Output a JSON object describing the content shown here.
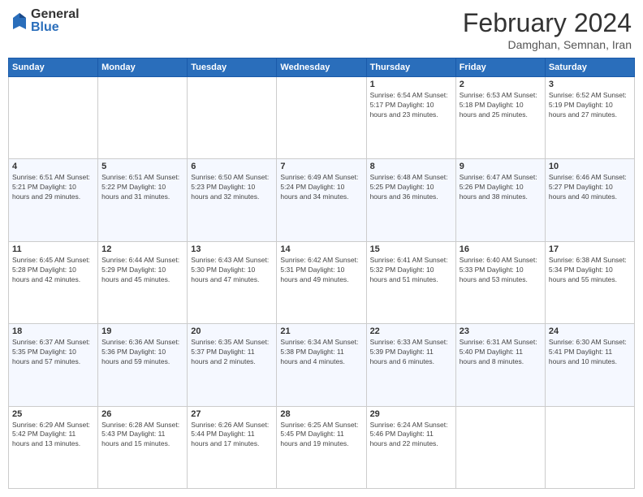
{
  "header": {
    "logo_general": "General",
    "logo_blue": "Blue",
    "title": "February 2024",
    "location": "Damghan, Semnan, Iran"
  },
  "days_of_week": [
    "Sunday",
    "Monday",
    "Tuesday",
    "Wednesday",
    "Thursday",
    "Friday",
    "Saturday"
  ],
  "weeks": [
    [
      {
        "day": "",
        "info": ""
      },
      {
        "day": "",
        "info": ""
      },
      {
        "day": "",
        "info": ""
      },
      {
        "day": "",
        "info": ""
      },
      {
        "day": "1",
        "info": "Sunrise: 6:54 AM\nSunset: 5:17 PM\nDaylight: 10 hours\nand 23 minutes."
      },
      {
        "day": "2",
        "info": "Sunrise: 6:53 AM\nSunset: 5:18 PM\nDaylight: 10 hours\nand 25 minutes."
      },
      {
        "day": "3",
        "info": "Sunrise: 6:52 AM\nSunset: 5:19 PM\nDaylight: 10 hours\nand 27 minutes."
      }
    ],
    [
      {
        "day": "4",
        "info": "Sunrise: 6:51 AM\nSunset: 5:21 PM\nDaylight: 10 hours\nand 29 minutes."
      },
      {
        "day": "5",
        "info": "Sunrise: 6:51 AM\nSunset: 5:22 PM\nDaylight: 10 hours\nand 31 minutes."
      },
      {
        "day": "6",
        "info": "Sunrise: 6:50 AM\nSunset: 5:23 PM\nDaylight: 10 hours\nand 32 minutes."
      },
      {
        "day": "7",
        "info": "Sunrise: 6:49 AM\nSunset: 5:24 PM\nDaylight: 10 hours\nand 34 minutes."
      },
      {
        "day": "8",
        "info": "Sunrise: 6:48 AM\nSunset: 5:25 PM\nDaylight: 10 hours\nand 36 minutes."
      },
      {
        "day": "9",
        "info": "Sunrise: 6:47 AM\nSunset: 5:26 PM\nDaylight: 10 hours\nand 38 minutes."
      },
      {
        "day": "10",
        "info": "Sunrise: 6:46 AM\nSunset: 5:27 PM\nDaylight: 10 hours\nand 40 minutes."
      }
    ],
    [
      {
        "day": "11",
        "info": "Sunrise: 6:45 AM\nSunset: 5:28 PM\nDaylight: 10 hours\nand 42 minutes."
      },
      {
        "day": "12",
        "info": "Sunrise: 6:44 AM\nSunset: 5:29 PM\nDaylight: 10 hours\nand 45 minutes."
      },
      {
        "day": "13",
        "info": "Sunrise: 6:43 AM\nSunset: 5:30 PM\nDaylight: 10 hours\nand 47 minutes."
      },
      {
        "day": "14",
        "info": "Sunrise: 6:42 AM\nSunset: 5:31 PM\nDaylight: 10 hours\nand 49 minutes."
      },
      {
        "day": "15",
        "info": "Sunrise: 6:41 AM\nSunset: 5:32 PM\nDaylight: 10 hours\nand 51 minutes."
      },
      {
        "day": "16",
        "info": "Sunrise: 6:40 AM\nSunset: 5:33 PM\nDaylight: 10 hours\nand 53 minutes."
      },
      {
        "day": "17",
        "info": "Sunrise: 6:38 AM\nSunset: 5:34 PM\nDaylight: 10 hours\nand 55 minutes."
      }
    ],
    [
      {
        "day": "18",
        "info": "Sunrise: 6:37 AM\nSunset: 5:35 PM\nDaylight: 10 hours\nand 57 minutes."
      },
      {
        "day": "19",
        "info": "Sunrise: 6:36 AM\nSunset: 5:36 PM\nDaylight: 10 hours\nand 59 minutes."
      },
      {
        "day": "20",
        "info": "Sunrise: 6:35 AM\nSunset: 5:37 PM\nDaylight: 11 hours\nand 2 minutes."
      },
      {
        "day": "21",
        "info": "Sunrise: 6:34 AM\nSunset: 5:38 PM\nDaylight: 11 hours\nand 4 minutes."
      },
      {
        "day": "22",
        "info": "Sunrise: 6:33 AM\nSunset: 5:39 PM\nDaylight: 11 hours\nand 6 minutes."
      },
      {
        "day": "23",
        "info": "Sunrise: 6:31 AM\nSunset: 5:40 PM\nDaylight: 11 hours\nand 8 minutes."
      },
      {
        "day": "24",
        "info": "Sunrise: 6:30 AM\nSunset: 5:41 PM\nDaylight: 11 hours\nand 10 minutes."
      }
    ],
    [
      {
        "day": "25",
        "info": "Sunrise: 6:29 AM\nSunset: 5:42 PM\nDaylight: 11 hours\nand 13 minutes."
      },
      {
        "day": "26",
        "info": "Sunrise: 6:28 AM\nSunset: 5:43 PM\nDaylight: 11 hours\nand 15 minutes."
      },
      {
        "day": "27",
        "info": "Sunrise: 6:26 AM\nSunset: 5:44 PM\nDaylight: 11 hours\nand 17 minutes."
      },
      {
        "day": "28",
        "info": "Sunrise: 6:25 AM\nSunset: 5:45 PM\nDaylight: 11 hours\nand 19 minutes."
      },
      {
        "day": "29",
        "info": "Sunrise: 6:24 AM\nSunset: 5:46 PM\nDaylight: 11 hours\nand 22 minutes."
      },
      {
        "day": "",
        "info": ""
      },
      {
        "day": "",
        "info": ""
      }
    ]
  ]
}
